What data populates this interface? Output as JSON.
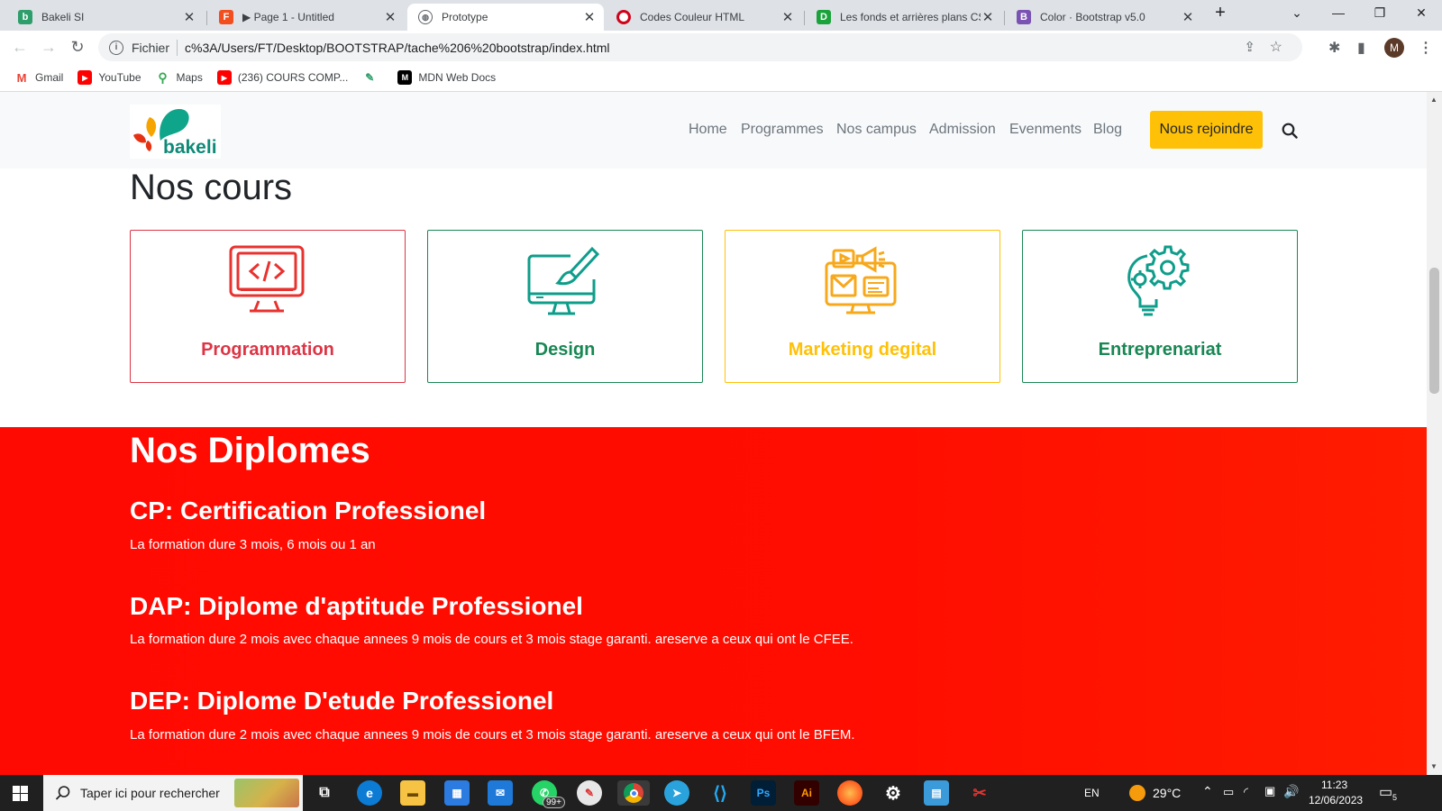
{
  "browser": {
    "tabs": [
      {
        "title": "Bakeli SI",
        "icon": "bakeli-favicon",
        "color": "#2e9e6b"
      },
      {
        "title": "▶ Page 1 - Untitled",
        "icon": "figma-favicon",
        "color": "#f24e1e"
      },
      {
        "title": "Prototype",
        "icon": "globe-favicon",
        "color": "#5f6368"
      },
      {
        "title": "Codes Couleur HTML",
        "icon": "opera-favicon",
        "color": "#d0021b"
      },
      {
        "title": "Les fonds et arrières plans CSS",
        "icon": "d-favicon",
        "color": "#1aa33a"
      },
      {
        "title": "Color · Bootstrap v5.0",
        "icon": "bootstrap-favicon",
        "color": "#7952b3"
      }
    ],
    "new_tab": "+",
    "omnibox": {
      "scheme_label": "Fichier",
      "url": "c%3A/Users/FT/Desktop/BOOTSTRAP/tache%206%20bootstrap/index.html"
    },
    "avatar": "M",
    "bookmarks": [
      {
        "label": "Gmail",
        "icon": "gmail-icon",
        "color": "#ea4335"
      },
      {
        "label": "YouTube",
        "icon": "youtube-icon",
        "color": "#ff0000"
      },
      {
        "label": "Maps",
        "icon": "maps-icon",
        "color": "#34a853"
      },
      {
        "label": "(236) COURS COMP...",
        "icon": "youtube-icon",
        "color": "#ff0000"
      },
      {
        "label": "",
        "icon": "bakeli-icon",
        "color": "#2e9e6b"
      },
      {
        "label": "MDN Web Docs",
        "icon": "mdn-icon",
        "color": "#000000"
      }
    ]
  },
  "site": {
    "logo_text": "bakeli",
    "nav": [
      "Home",
      "Programmes",
      "Nos campus",
      "Admission",
      "Evenments",
      "Blog"
    ],
    "cta": "Nous rejoindre",
    "courses_title": "Nos cours",
    "courses": [
      {
        "label": "Programmation",
        "icon": "code-monitor-icon",
        "color": "#dc3545"
      },
      {
        "label": "Design",
        "icon": "design-monitor-icon",
        "color": "#198754"
      },
      {
        "label": "Marketing degital",
        "icon": "marketing-icon",
        "color": "#ffc107"
      },
      {
        "label": "Entreprenariat",
        "icon": "bulb-gear-icon",
        "color": "#198754"
      }
    ],
    "diplomes_title": "Nos Diplomes",
    "diplomes": [
      {
        "title": "CP: Certification Professionel",
        "desc": "La formation dure 3 mois, 6 mois ou 1 an"
      },
      {
        "title": "DAP: Diplome d'aptitude Professionel",
        "desc": "La formation dure 2 mois avec chaque annees 9 mois de cours et 3 mois stage garanti. areserve a ceux qui ont le CFEE."
      },
      {
        "title": "DEP: Diplome D'etude Professionel",
        "desc": "La formation dure 2 mois avec chaque annees 9 mois de cours et 3 mois stage garanti. areserve a ceux qui ont le BFEM."
      }
    ]
  },
  "taskbar": {
    "search_placeholder": "Taper ici pour rechercher",
    "whatsapp_badge": "99+",
    "lang": "EN",
    "temperature": "29°C",
    "time": "11:23",
    "date": "12/06/2023",
    "notifications": "5"
  }
}
